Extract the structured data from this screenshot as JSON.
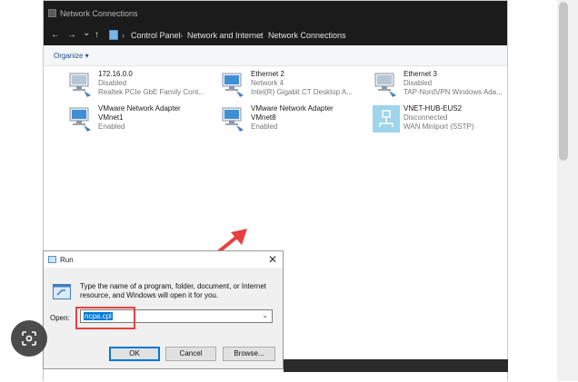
{
  "window": {
    "title": "Network Connections",
    "breadcrumb": [
      "Control Panel",
      "Network and Internet",
      "Network Connections"
    ],
    "nav": {
      "back": "←",
      "forward": "→",
      "recent": "⌄",
      "up": "↑",
      "sep": "›"
    },
    "organize_label": "Organize ▾"
  },
  "adapters": [
    {
      "name": "172.16.0.0",
      "status": "Disabled",
      "device": "Realtek PCIe GbE Family Cont...",
      "icon": "network-adapter-icon"
    },
    {
      "name": "Ethernet 2",
      "status": "Network 4",
      "device": "Intel(R) Gigabit CT Desktop A...",
      "icon": "network-adapter-icon"
    },
    {
      "name": "Ethernet 3",
      "status": "Disabled",
      "device": "TAP-NordVPN Windows Ada...",
      "icon": "network-adapter-icon"
    },
    {
      "name": "VMware Network Adapter",
      "status": "VMnet1",
      "device": "Enabled",
      "icon": "network-adapter-icon"
    },
    {
      "name": "VMware Network Adapter",
      "status": "VMnet8",
      "device": "Enabled",
      "icon": "network-adapter-icon"
    },
    {
      "name": "VNET-HUB-EUS2",
      "status": "Disconnected",
      "device": "WAN Miniport (SSTP)",
      "icon": "vpn-connection-icon"
    }
  ],
  "run_dialog": {
    "title": "Run",
    "close": "✕",
    "description": "Type the name of a program, folder, document, or Internet resource, and Windows will open it for you.",
    "open_label": "Open:",
    "open_value": "ncpa.cpl",
    "ok": "OK",
    "cancel": "Cancel",
    "browse": "Browse..."
  },
  "colors": {
    "annotation": "#e84040",
    "accent": "#0078d7"
  }
}
